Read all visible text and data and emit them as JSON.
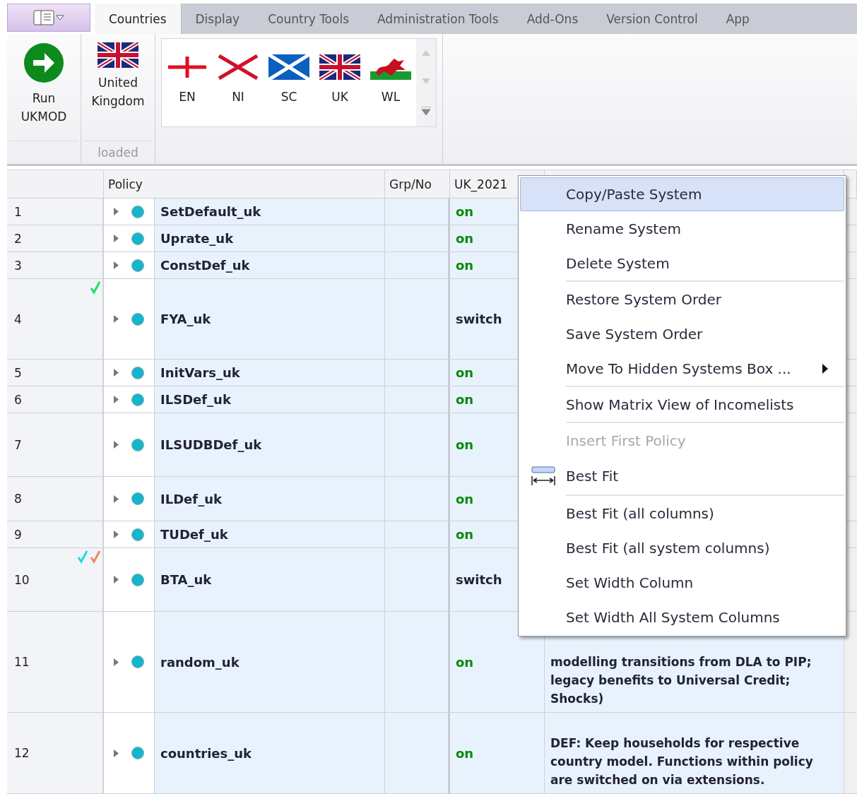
{
  "ribbon": {
    "tabs": [
      {
        "label": "Countries",
        "selected": true
      },
      {
        "label": "Display",
        "selected": false
      },
      {
        "label": "Country Tools",
        "selected": false
      },
      {
        "label": "Administration Tools",
        "selected": false
      },
      {
        "label": "Add-Ons",
        "selected": false
      },
      {
        "label": "Version Control",
        "selected": false
      },
      {
        "label": "App",
        "selected": false
      }
    ],
    "run_button": {
      "label": "Run UKMOD"
    },
    "country_button": {
      "label": "United Kingdom",
      "group_label": "loaded"
    },
    "flags": [
      {
        "label": "EN",
        "kind": "england"
      },
      {
        "label": "NI",
        "kind": "saltire-red"
      },
      {
        "label": "SC",
        "kind": "scotland"
      },
      {
        "label": "UK",
        "kind": "union"
      },
      {
        "label": "WL",
        "kind": "wales"
      }
    ]
  },
  "table": {
    "columns": [
      "Policy",
      "Grp/No",
      "UK_2021"
    ],
    "rows": [
      {
        "number": "1",
        "policy": "SetDefault_uk",
        "status": "on",
        "kind": "on",
        "marks": []
      },
      {
        "number": "2",
        "policy": "Uprate_uk",
        "status": "on",
        "kind": "on",
        "marks": []
      },
      {
        "number": "3",
        "policy": "ConstDef_uk",
        "status": "on",
        "kind": "on",
        "marks": []
      },
      {
        "number": "4",
        "policy": "FYA_uk",
        "status": "switch",
        "kind": "switch",
        "marks": [
          {
            "color": "#22e06a"
          }
        ]
      },
      {
        "number": "5",
        "policy": "InitVars_uk",
        "status": "on",
        "kind": "on",
        "marks": []
      },
      {
        "number": "6",
        "policy": "ILSDef_uk",
        "status": "on",
        "kind": "on",
        "marks": []
      },
      {
        "number": "7",
        "policy": "ILSUDBDef_uk",
        "status": "on",
        "kind": "on",
        "marks": []
      },
      {
        "number": "8",
        "policy": "ILDef_uk",
        "status": "on",
        "kind": "on",
        "marks": []
      },
      {
        "number": "9",
        "policy": "TUDef_uk",
        "status": "on",
        "kind": "on",
        "marks": []
      },
      {
        "number": "10",
        "policy": "BTA_uk",
        "status": "switch",
        "kind": "switch",
        "marks": [
          {
            "color": "#1fd6f0"
          },
          {
            "color": "#e88a6a"
          }
        ]
      },
      {
        "number": "11",
        "policy": "random_uk",
        "status": "on",
        "kind": "on",
        "marks": [],
        "comment": "modelling transitions from DLA to PIP; legacy benefits to Universal Credit; Shocks)"
      },
      {
        "number": "12",
        "policy": "countries_uk",
        "status": "on",
        "kind": "on",
        "marks": [],
        "comment": "DEF: Keep households for respective country model. Functions within policy are switched on via extensions."
      }
    ]
  },
  "context_menu": [
    {
      "label": "Copy/Paste System",
      "selected": true,
      "disabled": false,
      "divider_above": false,
      "submenu": false,
      "icon": false
    },
    {
      "label": "Rename System",
      "selected": false,
      "disabled": false,
      "divider_above": false,
      "submenu": false,
      "icon": false
    },
    {
      "label": "Delete System",
      "selected": false,
      "disabled": false,
      "divider_above": false,
      "submenu": false,
      "icon": false
    },
    {
      "label": "Restore System Order",
      "selected": false,
      "disabled": false,
      "divider_above": true,
      "submenu": false,
      "icon": false
    },
    {
      "label": "Save System Order",
      "selected": false,
      "disabled": false,
      "divider_above": false,
      "submenu": false,
      "icon": false
    },
    {
      "label": "Move To Hidden Systems Box ...",
      "selected": false,
      "disabled": false,
      "divider_above": false,
      "submenu": true,
      "icon": false
    },
    {
      "label": "Show Matrix View of Incomelists",
      "selected": false,
      "disabled": false,
      "divider_above": true,
      "submenu": false,
      "icon": false
    },
    {
      "label": "Insert First Policy",
      "selected": false,
      "disabled": true,
      "divider_above": true,
      "submenu": false,
      "icon": false
    },
    {
      "label": "Best Fit",
      "selected": false,
      "disabled": false,
      "divider_above": false,
      "submenu": false,
      "icon": true
    },
    {
      "label": "Best Fit (all columns)",
      "selected": false,
      "disabled": false,
      "divider_above": true,
      "submenu": false,
      "icon": false
    },
    {
      "label": "Best Fit (all system columns)",
      "selected": false,
      "disabled": false,
      "divider_above": false,
      "submenu": false,
      "icon": false
    },
    {
      "label": "Set Width Column",
      "selected": false,
      "disabled": false,
      "divider_above": false,
      "submenu": false,
      "icon": false
    },
    {
      "label": "Set Width All System Columns",
      "selected": false,
      "disabled": false,
      "divider_above": false,
      "submenu": false,
      "icon": false
    }
  ]
}
